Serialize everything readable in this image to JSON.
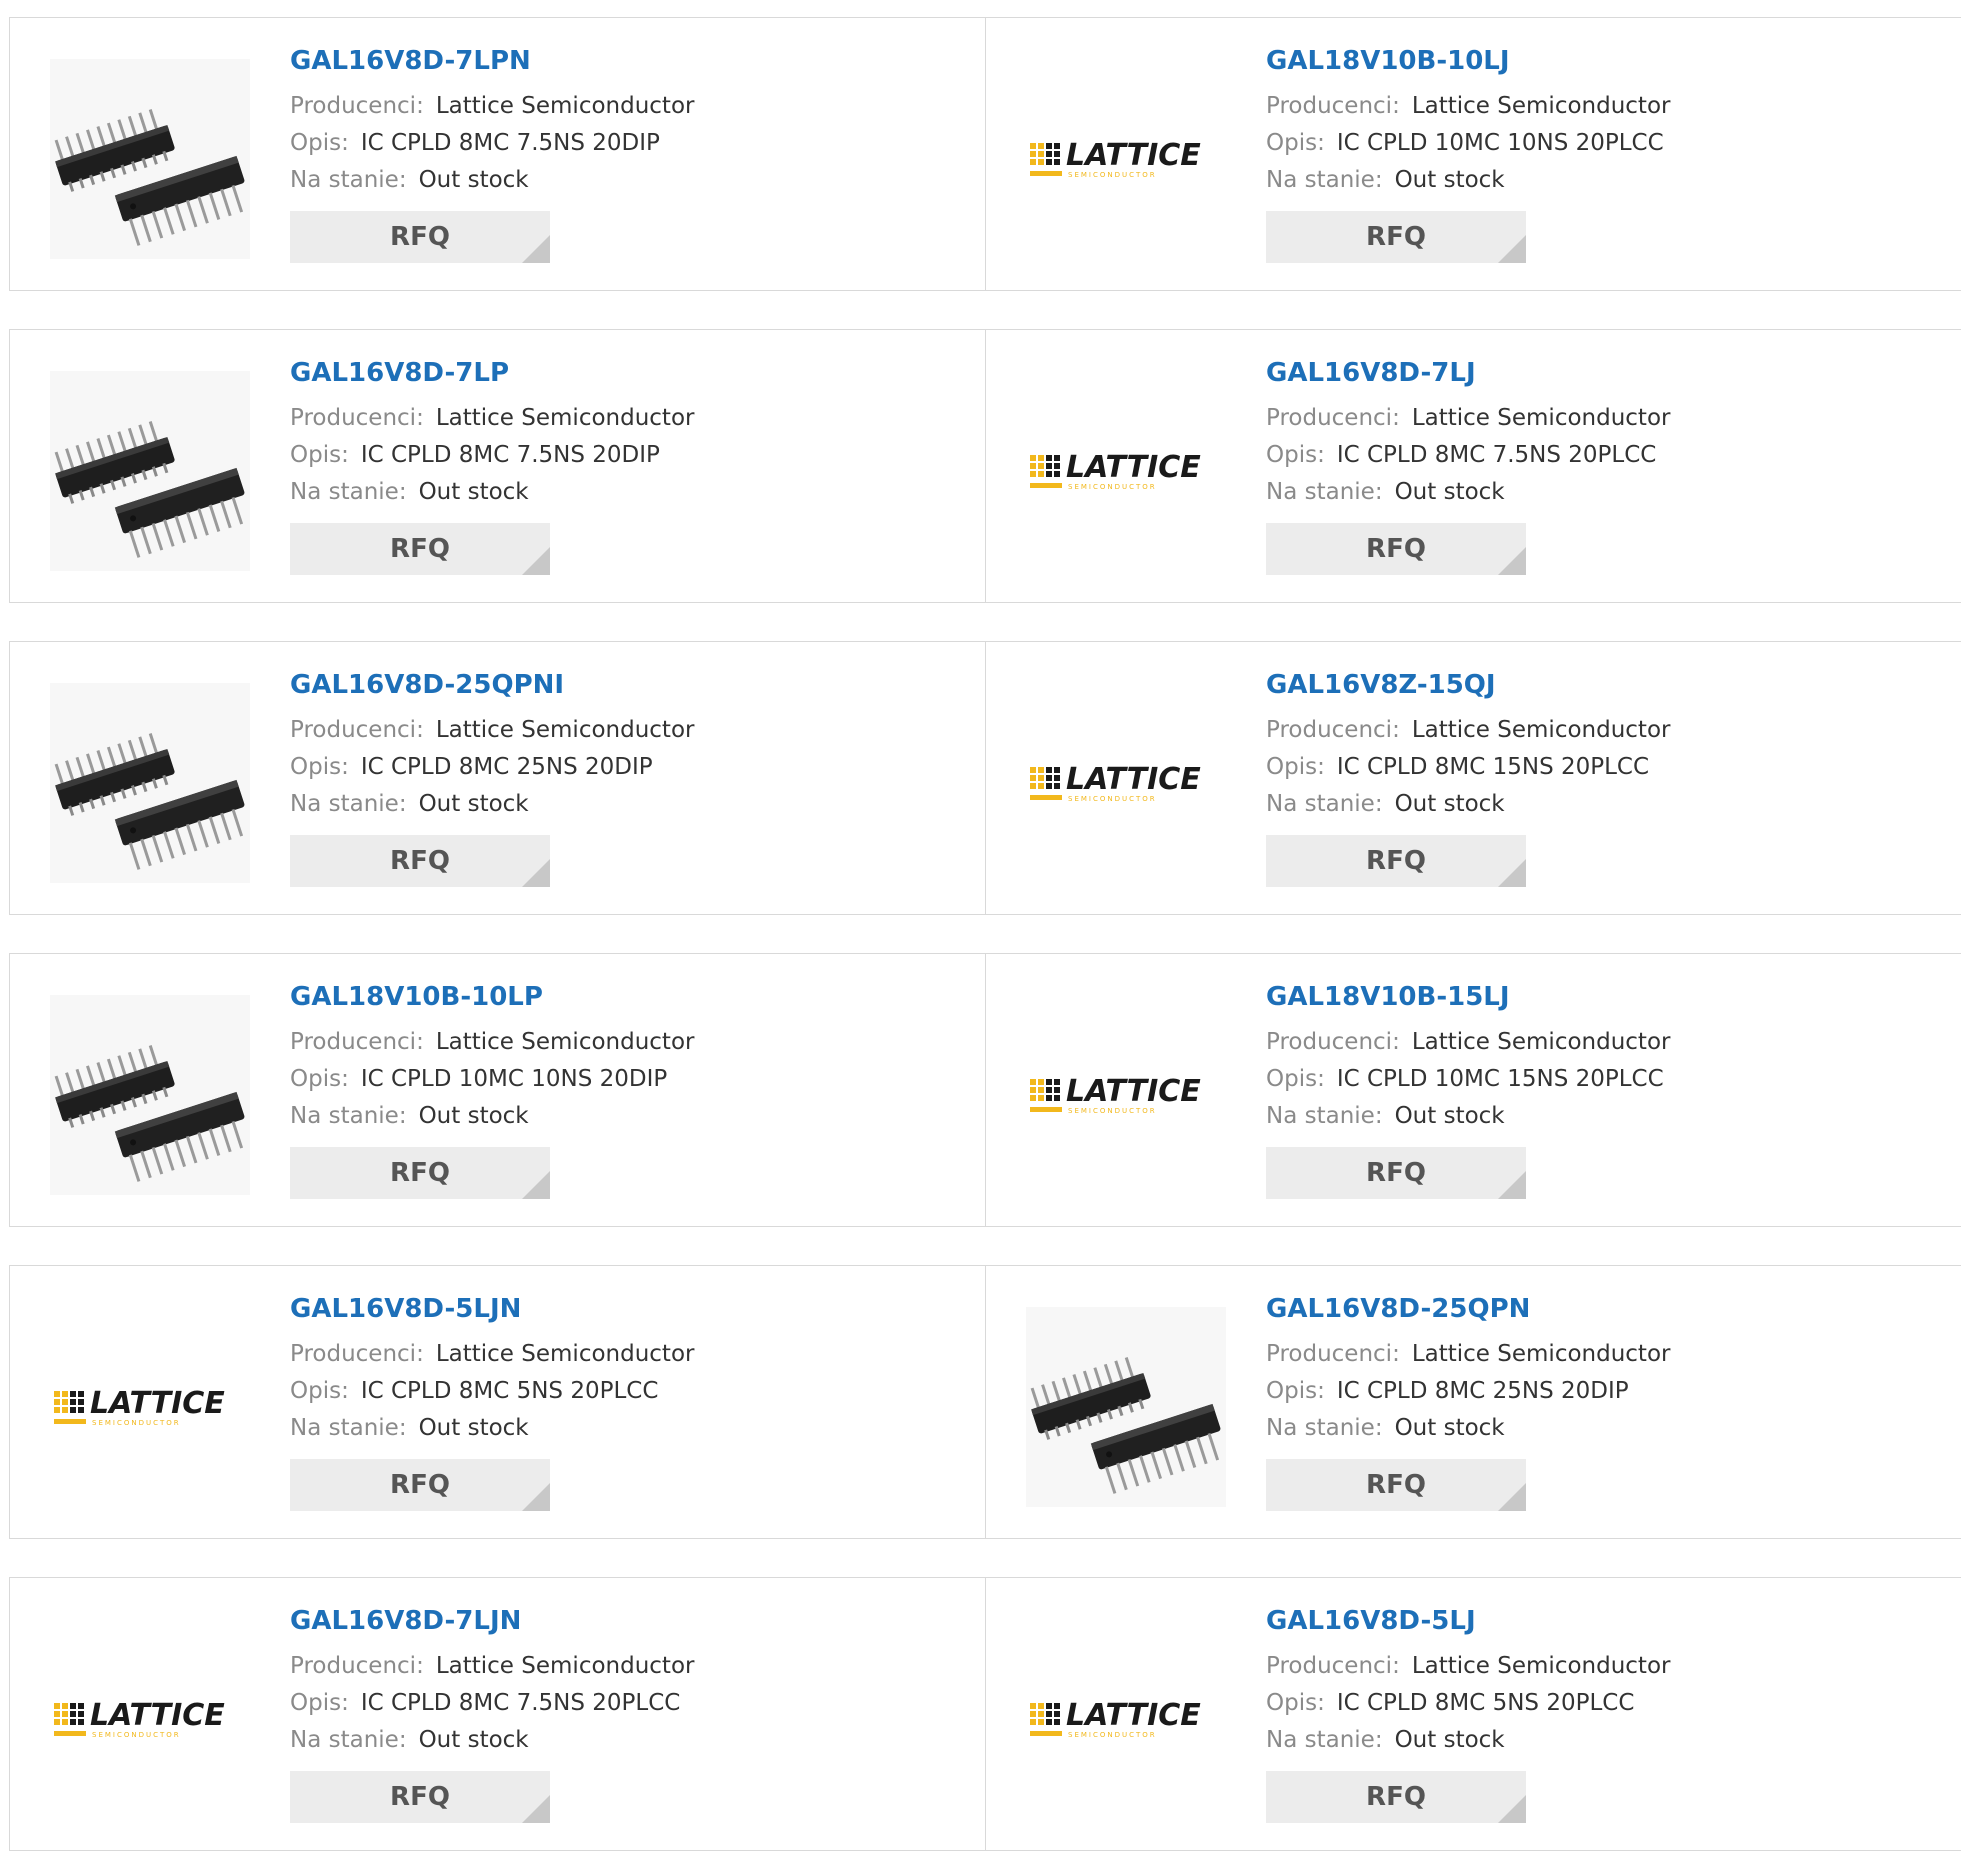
{
  "labels": {
    "manufacturer": "Producenci:",
    "description": "Opis:",
    "stock": "Na stanie:",
    "rfq": "RFQ"
  },
  "colors": {
    "part_link": "#1d6fb8",
    "label_gray": "#8a8a8a",
    "button_bg": "#ececec",
    "border": "#d9d9d9",
    "logo_gold": "#f2b81c"
  },
  "logo_text": {
    "main": "LATTICE",
    "sub": "SEMICONDUCTOR"
  },
  "products": [
    {
      "part": "GAL16V8D-7LPN",
      "image": "dip-chip-icon",
      "manufacturer": "Lattice Semiconductor",
      "description": "IC CPLD 8MC 7.5NS 20DIP",
      "stock": "Out stock"
    },
    {
      "part": "GAL18V10B-10LJ",
      "image": "lattice-logo",
      "manufacturer": "Lattice Semiconductor",
      "description": "IC CPLD 10MC 10NS 20PLCC",
      "stock": "Out stock"
    },
    {
      "part": "GAL16V8D-7LP",
      "image": "dip-chip-icon",
      "manufacturer": "Lattice Semiconductor",
      "description": "IC CPLD 8MC 7.5NS 20DIP",
      "stock": "Out stock"
    },
    {
      "part": "GAL16V8D-7LJ",
      "image": "lattice-logo",
      "manufacturer": "Lattice Semiconductor",
      "description": "IC CPLD 8MC 7.5NS 20PLCC",
      "stock": "Out stock"
    },
    {
      "part": "GAL16V8D-25QPNI",
      "image": "dip-chip-icon",
      "manufacturer": "Lattice Semiconductor",
      "description": "IC CPLD 8MC 25NS 20DIP",
      "stock": "Out stock"
    },
    {
      "part": "GAL16V8Z-15QJ",
      "image": "lattice-logo",
      "manufacturer": "Lattice Semiconductor",
      "description": "IC CPLD 8MC 15NS 20PLCC",
      "stock": "Out stock"
    },
    {
      "part": "GAL18V10B-10LP",
      "image": "dip-chip-icon",
      "manufacturer": "Lattice Semiconductor",
      "description": "IC CPLD 10MC 10NS 20DIP",
      "stock": "Out stock"
    },
    {
      "part": "GAL18V10B-15LJ",
      "image": "lattice-logo",
      "manufacturer": "Lattice Semiconductor",
      "description": "IC CPLD 10MC 15NS 20PLCC",
      "stock": "Out stock"
    },
    {
      "part": "GAL16V8D-5LJN",
      "image": "lattice-logo",
      "manufacturer": "Lattice Semiconductor",
      "description": "IC CPLD 8MC 5NS 20PLCC",
      "stock": "Out stock"
    },
    {
      "part": "GAL16V8D-25QPN",
      "image": "dip-chip-icon",
      "manufacturer": "Lattice Semiconductor",
      "description": "IC CPLD 8MC 25NS 20DIP",
      "stock": "Out stock"
    },
    {
      "part": "GAL16V8D-7LJN",
      "image": "lattice-logo",
      "manufacturer": "Lattice Semiconductor",
      "description": "IC CPLD 8MC 7.5NS 20PLCC",
      "stock": "Out stock"
    },
    {
      "part": "GAL16V8D-5LJ",
      "image": "lattice-logo",
      "manufacturer": "Lattice Semiconductor",
      "description": "IC CPLD 8MC 5NS 20PLCC",
      "stock": "Out stock"
    }
  ]
}
